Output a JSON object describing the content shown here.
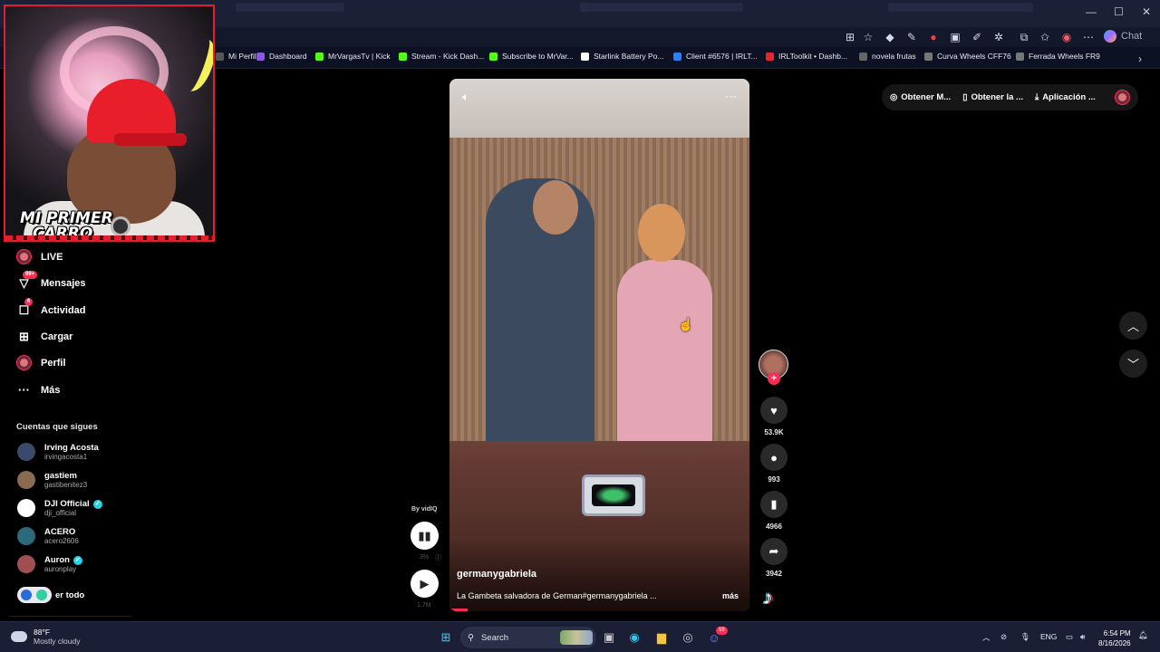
{
  "browser": {
    "window_controls": [
      "—",
      "☐",
      "✕"
    ],
    "copilot_label": "Chat",
    "bookmarks": [
      {
        "label": "Mi Perfil",
        "color": "#555"
      },
      {
        "label": "Dashboard",
        "color": "#8a56e6"
      },
      {
        "label": "MrVargasTv | Kick",
        "color": "#53fc18"
      },
      {
        "label": "Stream - Kick Dash...",
        "color": "#53fc18"
      },
      {
        "label": "Subscribe to MrVar...",
        "color": "#53fc18"
      },
      {
        "label": "Starlink Battery Po...",
        "color": "#ffffff"
      },
      {
        "label": "Client #6576 | IRLT...",
        "color": "#2d7ff9"
      },
      {
        "label": "IRLToolkit • Dashb...",
        "color": "#e3262f"
      },
      {
        "label": "novela frutas",
        "color": "#666"
      },
      {
        "label": "Curva Wheels CFF76",
        "color": "#777"
      },
      {
        "label": "Ferrada Wheels FR9",
        "color": "#777"
      }
    ]
  },
  "webcam": {
    "overlay_line1": "MI PRIMER",
    "overlay_line2": "CARRO"
  },
  "sidebar": {
    "nav": [
      {
        "label": "LIVE",
        "icon": "live-avatar"
      },
      {
        "label": "Mensajes",
        "icon": "messages-icon",
        "badge": "99+"
      },
      {
        "label": "Actividad",
        "icon": "activity-icon",
        "badge": "6"
      },
      {
        "label": "Cargar",
        "icon": "upload-icon"
      },
      {
        "label": "Perfil",
        "icon": "profile-avatar"
      },
      {
        "label": "Más",
        "icon": "more-icon"
      }
    ],
    "following_title": "Cuentas que sigues",
    "following": [
      {
        "name": "Irving Acosta",
        "handle": "irvingacosta1",
        "verified": false,
        "color": "#3a4a6a"
      },
      {
        "name": "gastiem",
        "handle": "gastibenitez3",
        "verified": false,
        "color": "#8a6a50"
      },
      {
        "name": "DJI Official",
        "handle": "dji_official",
        "verified": true,
        "color": "#ffffff"
      },
      {
        "name": "ACERO",
        "handle": "acero2606",
        "verified": false,
        "color": "#2a6a7a"
      },
      {
        "name": "Auron",
        "handle": "auronplay",
        "verified": true,
        "color": "#a05050"
      }
    ],
    "see_all": "er todo"
  },
  "video": {
    "author": "germanygabriela",
    "description": "La Gambeta salvadora de German#germanygabriela ...",
    "more": "más",
    "progress": 0.06,
    "vidiq_by": "By vidIQ",
    "vidiq_percent": "3%",
    "vidiq_views": "1.7M"
  },
  "actions": {
    "likes": "53.9K",
    "comments": "993",
    "saves": "4966",
    "shares": "3942"
  },
  "top_right": {
    "coins": "Obtener M...",
    "app": "Obtener la ...",
    "download": "Aplicación ..."
  },
  "taskbar": {
    "temperature": "88°F",
    "weather": "Mostly cloudy",
    "search": "Search",
    "lang": "ENG",
    "time": "6:54 PM",
    "date": "8/16/2026",
    "discord_badge": "59"
  }
}
